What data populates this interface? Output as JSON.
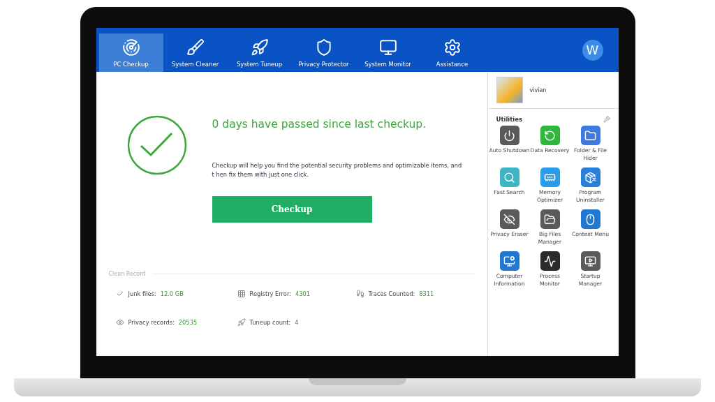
{
  "nav": {
    "tabs": [
      {
        "label": "PC Checkup",
        "kind": "radar",
        "selected": true
      },
      {
        "label": "System Cleaner",
        "kind": "brush",
        "selected": false
      },
      {
        "label": "System Tuneup",
        "kind": "rocket",
        "selected": false
      },
      {
        "label": "Privacy Protector",
        "kind": "shield",
        "selected": false
      },
      {
        "label": "System Monitor",
        "kind": "monitor",
        "selected": false
      },
      {
        "label": "Assistance",
        "kind": "gear",
        "selected": false
      }
    ],
    "account_badge": "W"
  },
  "checkup": {
    "headline": "0 days have passed since last checkup.",
    "description": "Checkup will help you find the potential security problems and optimizable items, and t hen fix them with just one click.",
    "button": "Checkup"
  },
  "clean_record": {
    "title": "Clean Record",
    "stats": [
      {
        "kind": "check",
        "label": "Junk files:",
        "value": "12.0 GB"
      },
      {
        "kind": "grid",
        "label": "Registry Error:",
        "value": "4301"
      },
      {
        "kind": "feet",
        "label": "Traces Counted:",
        "value": "8311"
      },
      {
        "kind": "eye",
        "label": "Privacy records:",
        "value": "20535"
      },
      {
        "kind": "rocket",
        "label": "Tuneup count:",
        "value": "4"
      }
    ]
  },
  "sidebar": {
    "user": "vivian",
    "utilities_title": "Utilities",
    "utilities": [
      {
        "kind": "power",
        "label": "Auto Shutdown",
        "color": "#5a5a5a"
      },
      {
        "kind": "recovery",
        "label": "Data Recovery",
        "color": "#2db83d"
      },
      {
        "kind": "folder",
        "label": "Folder & File Hider",
        "color": "#3d7be0"
      },
      {
        "kind": "search",
        "label": "Fast Search",
        "color": "#3fb4c4"
      },
      {
        "kind": "memory",
        "label": "Memory Optimizer",
        "color": "#2a9de8"
      },
      {
        "kind": "uninstall",
        "label": "Program Uninstaller",
        "color": "#2a7fd8"
      },
      {
        "kind": "eyeoff",
        "label": "Privacy Eraser",
        "color": "#5a5a5a"
      },
      {
        "kind": "files",
        "label": "Big Files Manager",
        "color": "#5a5a5a"
      },
      {
        "kind": "mouse",
        "label": "Context Menu",
        "color": "#1f78d1"
      },
      {
        "kind": "computer",
        "label": "Computer Information",
        "color": "#1f78d1"
      },
      {
        "kind": "pulse",
        "label": "Process Monitor",
        "color": "#2b2b2b"
      },
      {
        "kind": "startup",
        "label": "Startup Manager",
        "color": "#5a5a5a"
      }
    ]
  }
}
